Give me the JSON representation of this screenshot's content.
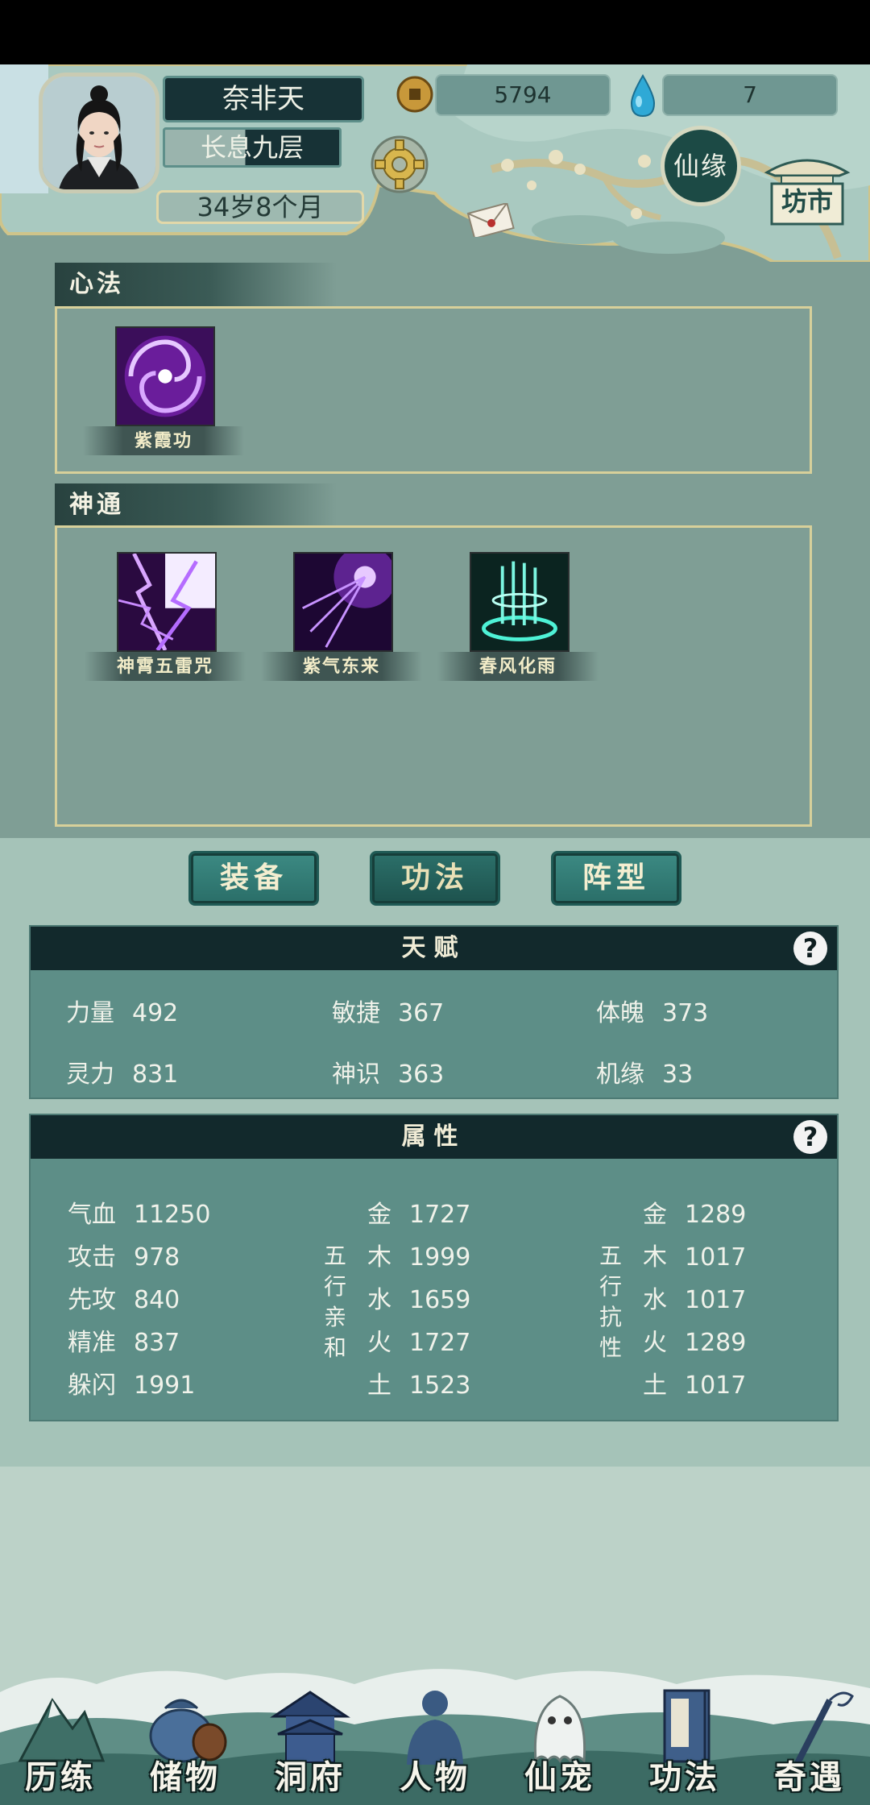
{
  "header": {
    "name": "奈非天",
    "realm": "长息九层",
    "age": "34岁8个月",
    "coins": "5794",
    "gems": "7",
    "xianyuan_label": "仙缘",
    "fangshi_label": "坊市"
  },
  "xinfa": {
    "title": "心法",
    "skills": [
      {
        "name": "紫霞功",
        "icon": "purple-vortex-icon"
      }
    ]
  },
  "shentong": {
    "title": "神通",
    "skills": [
      {
        "name": "神霄五雷咒",
        "icon": "purple-lightning-icon"
      },
      {
        "name": "紫气东来",
        "icon": "purple-energy-icon"
      },
      {
        "name": "春风化雨",
        "icon": "cyan-rain-icon"
      }
    ]
  },
  "tabs": [
    {
      "label": "装备",
      "active": false
    },
    {
      "label": "功法",
      "active": true
    },
    {
      "label": "阵型",
      "active": false
    }
  ],
  "talent": {
    "title": "天赋",
    "help": "?",
    "stats": [
      {
        "label": "力量",
        "value": "492"
      },
      {
        "label": "敏捷",
        "value": "367"
      },
      {
        "label": "体魄",
        "value": "373"
      },
      {
        "label": "灵力",
        "value": "831"
      },
      {
        "label": "神识",
        "value": "363"
      },
      {
        "label": "机缘",
        "value": "33"
      }
    ]
  },
  "attributes": {
    "title": "属性",
    "help": "?",
    "base": [
      {
        "label": "气血",
        "value": "11250"
      },
      {
        "label": "攻击",
        "value": "978"
      },
      {
        "label": "先攻",
        "value": "840"
      },
      {
        "label": "精准",
        "value": "837"
      },
      {
        "label": "躲闪",
        "value": "1991"
      }
    ],
    "affinity_title": [
      "五",
      "行",
      "亲",
      "和"
    ],
    "affinity": [
      {
        "label": "金",
        "value": "1727"
      },
      {
        "label": "木",
        "value": "1999"
      },
      {
        "label": "水",
        "value": "1659"
      },
      {
        "label": "火",
        "value": "1727"
      },
      {
        "label": "土",
        "value": "1523"
      }
    ],
    "resist_title": [
      "五",
      "行",
      "抗",
      "性"
    ],
    "resist": [
      {
        "label": "金",
        "value": "1289"
      },
      {
        "label": "木",
        "value": "1017"
      },
      {
        "label": "水",
        "value": "1017"
      },
      {
        "label": "火",
        "value": "1289"
      },
      {
        "label": "土",
        "value": "1017"
      }
    ]
  },
  "nav": [
    {
      "label": "历练",
      "icon": "mountain-icon"
    },
    {
      "label": "储物",
      "icon": "pouch-icon"
    },
    {
      "label": "洞府",
      "icon": "pagoda-icon"
    },
    {
      "label": "人物",
      "icon": "person-icon"
    },
    {
      "label": "仙宠",
      "icon": "ghost-pet-icon"
    },
    {
      "label": "功法",
      "icon": "book-icon"
    },
    {
      "label": "奇遇",
      "icon": "staff-icon"
    }
  ],
  "colors": {
    "panel": "#5d8e87",
    "panel_head": "#12292c",
    "background": "#7f9e95",
    "gold_border": "#d7d09a"
  }
}
